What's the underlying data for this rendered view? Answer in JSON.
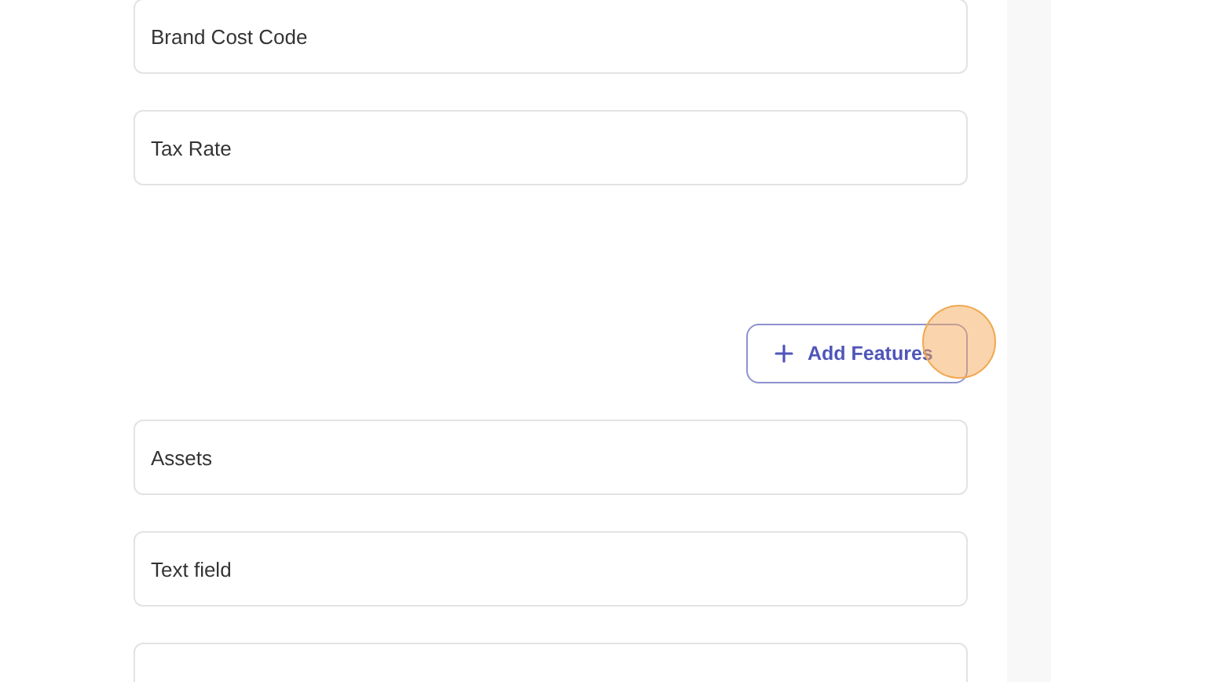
{
  "fields_top": [
    {
      "label": "Brand Cost Code"
    },
    {
      "label": "Tax Rate"
    }
  ],
  "add_button": {
    "label": "Add Features"
  },
  "fields_bottom": [
    {
      "label": "Assets"
    },
    {
      "label": "Text field"
    }
  ]
}
